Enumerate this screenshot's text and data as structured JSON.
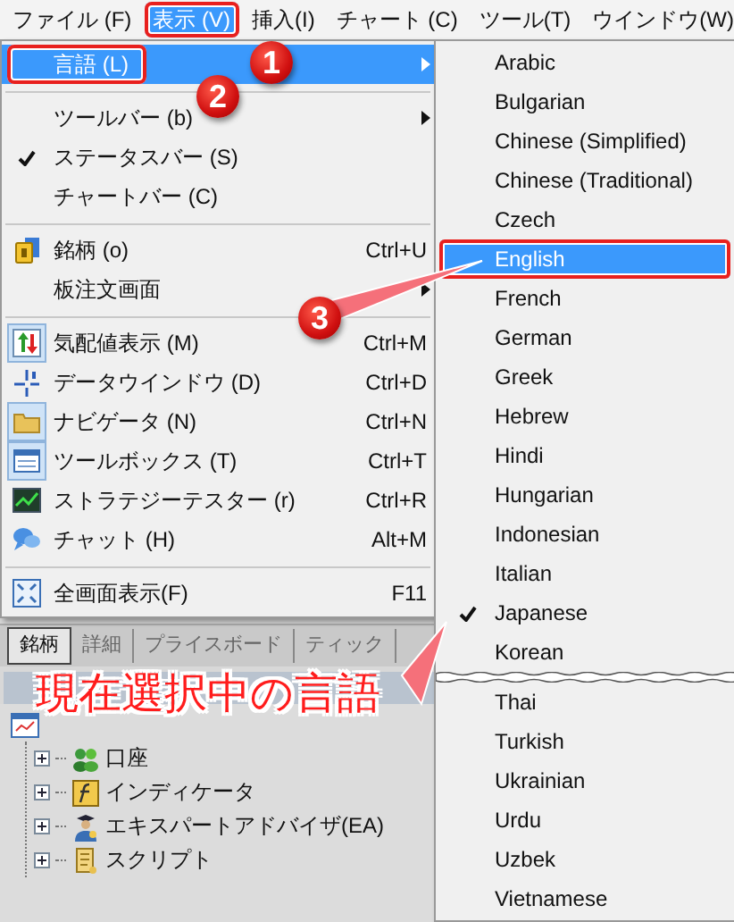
{
  "menubar": [
    {
      "label": "ファイル (F)",
      "selected": false,
      "outlined": false
    },
    {
      "label": "表示 (V)",
      "selected": true,
      "outlined": true
    },
    {
      "label": "挿入(I)",
      "selected": false,
      "outlined": false
    },
    {
      "label": "チャート (C)",
      "selected": false,
      "outlined": false
    },
    {
      "label": "ツール(T)",
      "selected": false,
      "outlined": false
    },
    {
      "label": "ウインドウ(W)",
      "selected": false,
      "outlined": false
    }
  ],
  "menu": [
    {
      "kind": "item",
      "label": "言語 (L)",
      "submenu": true,
      "checked": false,
      "selected": true,
      "outlined": true
    },
    {
      "kind": "separator"
    },
    {
      "kind": "item",
      "label": "ツールバー (b)",
      "submenu": true,
      "checked": false,
      "selected": false,
      "outlined": false
    },
    {
      "kind": "item",
      "label": "ステータスバー (S)",
      "submenu": false,
      "checked": true,
      "selected": false,
      "outlined": false
    },
    {
      "kind": "item",
      "label": "チャートバー (C)",
      "submenu": false,
      "checked": false,
      "selected": false,
      "outlined": false
    },
    {
      "kind": "separator"
    },
    {
      "kind": "item",
      "label": "銘柄 (o)",
      "shortcut": "Ctrl+U",
      "submenu": false,
      "checked": false,
      "selected": false,
      "outlined": false
    },
    {
      "kind": "item",
      "label": "板注文画面",
      "submenu": true,
      "checked": false,
      "selected": false,
      "outlined": false
    },
    {
      "kind": "separator"
    },
    {
      "kind": "item",
      "label": "気配値表示 (M)",
      "shortcut": "Ctrl+M",
      "submenu": false,
      "checked": true,
      "selected": false,
      "outlined": false
    },
    {
      "kind": "item",
      "label": "データウインドウ (D)",
      "shortcut": "Ctrl+D",
      "submenu": false,
      "checked": false,
      "selected": false,
      "outlined": false
    },
    {
      "kind": "item",
      "label": "ナビゲータ (N)",
      "shortcut": "Ctrl+N",
      "submenu": false,
      "checked": true,
      "selected": false,
      "outlined": false
    },
    {
      "kind": "item",
      "label": "ツールボックス (T)",
      "shortcut": "Ctrl+T",
      "submenu": false,
      "checked": true,
      "selected": false,
      "outlined": false
    },
    {
      "kind": "item",
      "label": "ストラテジーテスター (r)",
      "shortcut": "Ctrl+R",
      "submenu": false,
      "checked": false,
      "selected": false,
      "outlined": false
    },
    {
      "kind": "item",
      "label": "チャット (H)",
      "shortcut": "Alt+M",
      "submenu": false,
      "checked": false,
      "selected": false,
      "outlined": false
    },
    {
      "kind": "separator"
    },
    {
      "kind": "item",
      "label": "全画面表示(F)",
      "shortcut": "F11",
      "submenu": false,
      "checked": false,
      "selected": false,
      "outlined": false
    }
  ],
  "languages": [
    {
      "kind": "item",
      "label": "Arabic",
      "checked": false,
      "selected": false,
      "outlined": false
    },
    {
      "kind": "item",
      "label": "Bulgarian",
      "checked": false,
      "selected": false,
      "outlined": false
    },
    {
      "kind": "item",
      "label": "Chinese (Simplified)",
      "checked": false,
      "selected": false,
      "outlined": false
    },
    {
      "kind": "item",
      "label": "Chinese (Traditional)",
      "checked": false,
      "selected": false,
      "outlined": false
    },
    {
      "kind": "item",
      "label": "Czech",
      "checked": false,
      "selected": false,
      "outlined": false
    },
    {
      "kind": "item",
      "label": "English",
      "checked": false,
      "selected": true,
      "outlined": true
    },
    {
      "kind": "item",
      "label": "French",
      "checked": false,
      "selected": false,
      "outlined": false
    },
    {
      "kind": "item",
      "label": "German",
      "checked": false,
      "selected": false,
      "outlined": false
    },
    {
      "kind": "item",
      "label": "Greek",
      "checked": false,
      "selected": false,
      "outlined": false
    },
    {
      "kind": "item",
      "label": "Hebrew",
      "checked": false,
      "selected": false,
      "outlined": false
    },
    {
      "kind": "item",
      "label": "Hindi",
      "checked": false,
      "selected": false,
      "outlined": false
    },
    {
      "kind": "item",
      "label": "Hungarian",
      "checked": false,
      "selected": false,
      "outlined": false
    },
    {
      "kind": "item",
      "label": "Indonesian",
      "checked": false,
      "selected": false,
      "outlined": false
    },
    {
      "kind": "item",
      "label": "Italian",
      "checked": false,
      "selected": false,
      "outlined": false
    },
    {
      "kind": "item",
      "label": "Japanese",
      "checked": true,
      "selected": false,
      "outlined": false
    },
    {
      "kind": "item",
      "label": "Korean",
      "checked": false,
      "selected": false,
      "outlined": false
    },
    {
      "kind": "break"
    },
    {
      "kind": "item",
      "label": "Thai",
      "checked": false,
      "selected": false,
      "outlined": false
    },
    {
      "kind": "item",
      "label": "Turkish",
      "checked": false,
      "selected": false,
      "outlined": false
    },
    {
      "kind": "item",
      "label": "Ukrainian",
      "checked": false,
      "selected": false,
      "outlined": false
    },
    {
      "kind": "item",
      "label": "Urdu",
      "checked": false,
      "selected": false,
      "outlined": false
    },
    {
      "kind": "item",
      "label": "Uzbek",
      "checked": false,
      "selected": false,
      "outlined": false
    },
    {
      "kind": "item",
      "label": "Vietnamese",
      "checked": false,
      "selected": false,
      "outlined": false
    }
  ],
  "tabs": [
    {
      "label": "銘柄",
      "selected": true
    },
    {
      "label": "詳細",
      "selected": false
    },
    {
      "label": "プライスボード",
      "selected": false
    },
    {
      "label": "ティック",
      "selected": false
    }
  ],
  "navigator": {
    "children": [
      {
        "label": "口座",
        "expanded": false
      },
      {
        "label": "インディケータ",
        "expanded": false
      },
      {
        "label": "エキスパートアドバイザ(EA)",
        "expanded": false
      },
      {
        "label": "スクリプト",
        "expanded": false
      }
    ]
  },
  "annotations": {
    "steps": [
      "1",
      "2",
      "3"
    ],
    "note": "現在選択中の言語"
  }
}
